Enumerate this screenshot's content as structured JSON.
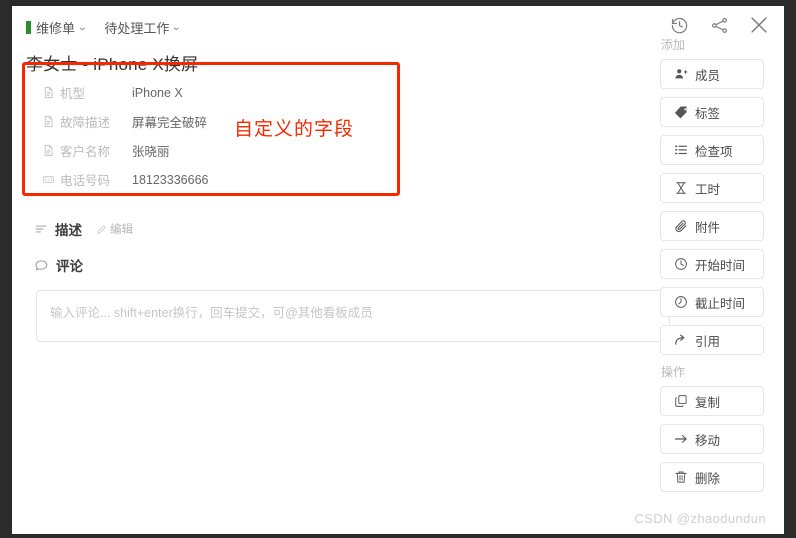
{
  "breadcrumb": {
    "items": [
      {
        "label": "维修单",
        "icon": "green-swatch",
        "caret": "⌄"
      },
      {
        "label": "待处理工作",
        "icon": "",
        "caret": "⌄"
      }
    ]
  },
  "window_icons": [
    {
      "name": "history-icon",
      "title": "历史"
    },
    {
      "name": "share-icon",
      "title": "分享"
    },
    {
      "name": "close-icon",
      "title": "关闭"
    }
  ],
  "card": {
    "title": "李女士 - iPhone X换屏",
    "annotation": "自定义的字段",
    "annotation_color": "#f72800",
    "fields": [
      {
        "icon": "document-icon",
        "label": "机型",
        "value": "iPhone X"
      },
      {
        "icon": "document-icon",
        "label": "故障描述",
        "value": "屏幕完全破碎"
      },
      {
        "icon": "document-icon",
        "label": "客户名称",
        "value": "张晓丽"
      },
      {
        "icon": "number-123-icon",
        "label": "电话号码",
        "value": "18123336666"
      }
    ]
  },
  "description_section": {
    "icon": "lines-icon",
    "title": "描述",
    "edit_icon": "pencil-icon",
    "edit_label": "编辑"
  },
  "comment_section": {
    "icon": "comment-icon",
    "title": "评论",
    "input_value": "",
    "input_placeholder": "输入评论... shift+enter换行，回车提交，可@其他看板成员"
  },
  "sidebar": {
    "add_label": "添加",
    "add_items": [
      {
        "icon": "member-add-icon",
        "label": "成员"
      },
      {
        "icon": "tag-icon",
        "label": "标签"
      },
      {
        "icon": "checklist-icon",
        "label": "检查项"
      },
      {
        "icon": "hourglass-icon",
        "label": "工时"
      },
      {
        "icon": "paperclip-icon",
        "label": "附件"
      },
      {
        "icon": "clock-start-icon",
        "label": "开始时间"
      },
      {
        "icon": "clock-due-icon",
        "label": "截止时间"
      },
      {
        "icon": "quote-arrow-icon",
        "label": "引用"
      }
    ],
    "actions_label": "操作",
    "action_items": [
      {
        "icon": "copy-icon",
        "label": "复制"
      },
      {
        "icon": "move-arrow-icon",
        "label": "移动"
      },
      {
        "icon": "trash-icon",
        "label": "删除"
      }
    ]
  },
  "watermark": "CSDN @zhaodundun"
}
